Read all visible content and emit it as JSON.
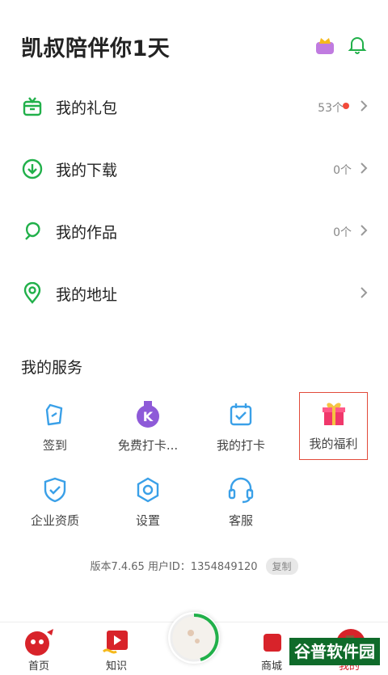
{
  "header": {
    "title": "凯叔陪伴你1天"
  },
  "menu": [
    {
      "label": "我的礼包",
      "count": "53个",
      "has_dot": true
    },
    {
      "label": "我的下载",
      "count": "0个"
    },
    {
      "label": "我的作品",
      "count": "0个"
    },
    {
      "label": "我的地址",
      "count": ""
    }
  ],
  "services": {
    "title": "我的服务",
    "items": [
      {
        "label": "签到",
        "icon": "tag-icon"
      },
      {
        "label": "免费打卡...",
        "icon": "k-medal-icon"
      },
      {
        "label": "我的打卡",
        "icon": "calendar-check-icon"
      },
      {
        "label": "我的福利",
        "icon": "gift-icon"
      },
      {
        "label": "企业资质",
        "icon": "shield-check-icon"
      },
      {
        "label": "设置",
        "icon": "settings-icon"
      },
      {
        "label": "客服",
        "icon": "headset-icon"
      }
    ]
  },
  "version": {
    "text": "版本7.4.65   用户ID：1354849120",
    "copy_label": "复制"
  },
  "tabbar": [
    {
      "label": "首页"
    },
    {
      "label": "知识"
    },
    {
      "label": "商城"
    },
    {
      "label": "我的"
    }
  ],
  "watermark": "谷普软件园",
  "colors": {
    "accent_green": "#21b04a",
    "service_blue": "#3aa0e8",
    "highlight_red": "#e24a3a",
    "gift_pink": "#f0386b"
  }
}
